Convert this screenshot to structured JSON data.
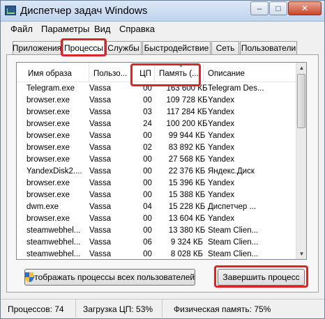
{
  "window": {
    "title": "Диспетчер задач Windows"
  },
  "title_buttons": {
    "minimize": "–",
    "maximize": "□",
    "close": "✕"
  },
  "menu": [
    "Файл",
    "Параметры",
    "Вид",
    "Справка"
  ],
  "tabs": [
    {
      "label": "Приложения"
    },
    {
      "label": "Процессы"
    },
    {
      "label": "Службы"
    },
    {
      "label": "Быстродействие"
    },
    {
      "label": "Сеть"
    },
    {
      "label": "Пользователи"
    }
  ],
  "active_tab": "Процессы",
  "columns": [
    "Имя образа",
    "Пользо...",
    "ЦП",
    "Память (...",
    "Описание"
  ],
  "sort_indicator": "▲",
  "rows": [
    {
      "name": "Telegram.exe",
      "user": "Vassa",
      "cpu": "00",
      "mem": "163 600 КБ",
      "desc": "Telegram Des..."
    },
    {
      "name": "browser.exe",
      "user": "Vassa",
      "cpu": "00",
      "mem": "109 728 КБ",
      "desc": "Yandex"
    },
    {
      "name": "browser.exe",
      "user": "Vassa",
      "cpu": "03",
      "mem": "117 284 КБ",
      "desc": "Yandex"
    },
    {
      "name": "browser.exe",
      "user": "Vassa",
      "cpu": "24",
      "mem": "100 200 КБ",
      "desc": "Yandex"
    },
    {
      "name": "browser.exe",
      "user": "Vassa",
      "cpu": "00",
      "mem": "99 944 КБ",
      "desc": "Yandex"
    },
    {
      "name": "browser.exe",
      "user": "Vassa",
      "cpu": "02",
      "mem": "83 892 КБ",
      "desc": "Yandex"
    },
    {
      "name": "browser.exe",
      "user": "Vassa",
      "cpu": "00",
      "mem": "27 568 КБ",
      "desc": "Yandex"
    },
    {
      "name": "YandexDisk2....",
      "user": "Vassa",
      "cpu": "00",
      "mem": "22 376 КБ",
      "desc": "Яндекс.Диск"
    },
    {
      "name": "browser.exe",
      "user": "Vassa",
      "cpu": "00",
      "mem": "15 396 КБ",
      "desc": "Yandex"
    },
    {
      "name": "browser.exe",
      "user": "Vassa",
      "cpu": "00",
      "mem": "15 388 КБ",
      "desc": "Yandex"
    },
    {
      "name": "dwm.exe",
      "user": "Vassa",
      "cpu": "04",
      "mem": "15 228 КБ",
      "desc": "Диспетчер ..."
    },
    {
      "name": "browser.exe",
      "user": "Vassa",
      "cpu": "00",
      "mem": "13 604 КБ",
      "desc": "Yandex"
    },
    {
      "name": "steamwebhel...",
      "user": "Vassa",
      "cpu": "00",
      "mem": "13 380 КБ",
      "desc": "Steam Clien..."
    },
    {
      "name": "steamwebhel...",
      "user": "Vassa",
      "cpu": "06",
      "mem": "9 324 КБ",
      "desc": "Steam Clien..."
    },
    {
      "name": "steamwebhel...",
      "user": "Vassa",
      "cpu": "00",
      "mem": "8 028 КБ",
      "desc": "Steam Clien..."
    }
  ],
  "scrollbar": {
    "up": "▲",
    "down": "▼"
  },
  "buttons": {
    "show_all": "Отображать процессы всех пользователей",
    "end_process": "Завершить процесс"
  },
  "status": {
    "processes": "Процессов: 74",
    "cpu": "Загрузка ЦП: 53%",
    "memory": "Физическая память: 75%"
  },
  "colors": {
    "highlight": "#d8262b",
    "title_bar": "#bfd4ee",
    "close_button": "#c9462c"
  }
}
